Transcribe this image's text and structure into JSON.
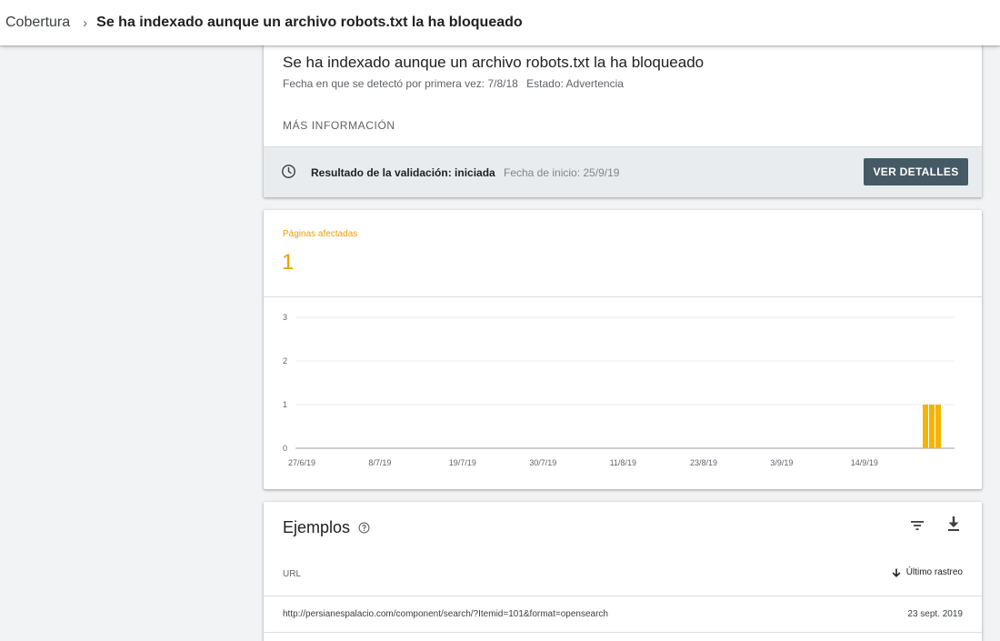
{
  "breadcrumb": {
    "root": "Cobertura",
    "separator": "›",
    "current": "Se ha indexado aunque un archivo robots.txt la ha bloqueado"
  },
  "issue": {
    "title": "Se ha indexado aunque un archivo robots.txt la ha bloqueado",
    "first_detected": "Fecha en que se detectó por primera vez: 7/8/18",
    "status": "Estado: Advertencia",
    "more_info": "MÁS INFORMACIÓN"
  },
  "validation": {
    "icon": "clock-icon",
    "label": "Resultado de la validación: iniciada",
    "start_date": "Fecha de inicio: 25/9/19",
    "details_button": "VER DETALLES",
    "band_color": "#e8ecef",
    "button_color": "#455a64"
  },
  "affected": {
    "label": "Páginas afectadas",
    "value": "1",
    "color": "#e8a000"
  },
  "chart_data": {
    "type": "bar",
    "ylim": [
      0,
      3
    ],
    "y_ticks": [
      "0",
      "1",
      "2",
      "3"
    ],
    "x_ticks": [
      "27/6/19",
      "8/7/19",
      "19/7/19",
      "30/7/19",
      "11/8/19",
      "23/8/19",
      "3/9/19",
      "14/9/19"
    ],
    "bar_color": "#f4b400",
    "series": [
      {
        "dates": [
          "24/9/19",
          "25/9/19",
          "26/9/19"
        ],
        "values": [
          1,
          1,
          1
        ]
      }
    ],
    "grid": true
  },
  "examples": {
    "title": "Ejemplos",
    "help_icon": "help-circle-icon",
    "filter_icon": "filter-icon",
    "download_icon": "download-icon",
    "col_url": "URL",
    "col_last_crawl": "Último rastreo",
    "rows": [
      {
        "url": "http://persianespalacio.com/component/search/?Itemid=101&format=opensearch",
        "date": "23 sept. 2019"
      }
    ]
  }
}
